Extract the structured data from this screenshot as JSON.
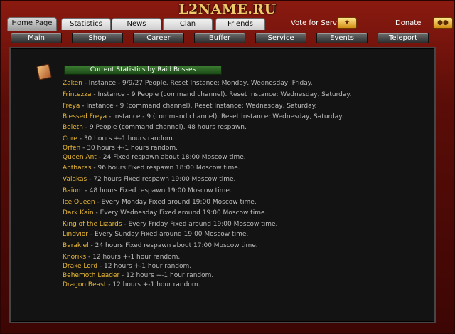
{
  "header": {
    "title": "L2NAME.RU"
  },
  "tabs": [
    {
      "label": "Home Page",
      "active": true
    },
    {
      "label": "Statistics",
      "active": false
    },
    {
      "label": "News",
      "active": false
    },
    {
      "label": "Clan",
      "active": false
    },
    {
      "label": "Friends",
      "active": false
    }
  ],
  "vote": {
    "label": "Vote for Server"
  },
  "donate": {
    "label": "Donate"
  },
  "menu": [
    {
      "label": "Main"
    },
    {
      "label": "Shop"
    },
    {
      "label": "Career"
    },
    {
      "label": "Buffer"
    },
    {
      "label": "Service"
    },
    {
      "label": "Events"
    },
    {
      "label": "Teleport"
    }
  ],
  "content": {
    "heading": "Current Statistics by Raid Bosses",
    "bosses": [
      {
        "name": "Zaken",
        "desc": " - Instance - 9/9/27 People. Reset Instance: Monday, Wednesday, Friday."
      },
      {
        "name": "Frintezza",
        "desc": " - Instance - 9 People  (command channel). Reset Instance: Wednesday, Saturday."
      },
      {
        "name": "Freya",
        "desc": " - Instance - 9  (command channel). Reset Instance: Wednesday, Saturday."
      },
      {
        "name": "Blessed Freya",
        "desc": " - Instance - 9 (command channel). Reset Instance: Wednesday, Saturday."
      },
      {
        "name": "Beleth",
        "desc": " - 9 People (command channel). 48 hours respawn."
      },
      {
        "name": "Core",
        "desc": " - 30 hours +-1 hours random."
      },
      {
        "name": "Orfen",
        "desc": " - 30 hours +-1 hours random."
      },
      {
        "name": "Queen Ant",
        "desc": " - 24 Fixed respawn about 18:00 Moscow time."
      },
      {
        "name": "Antharas",
        "desc": " - 96 hours Fixed respawn 18:00 Moscow time."
      },
      {
        "name": "Valakas",
        "desc": " - 72 hours Fixed respawn 19:00 Moscow time."
      },
      {
        "name": "Baium",
        "desc": " - 48 hours Fixed respawn 19:00 Moscow time."
      },
      {
        "name": "Ice Queen",
        "desc": " - Every Monday Fixed around 19:00 Moscow time."
      },
      {
        "name": "Dark Kain",
        "desc": " - Every Wednesday Fixed around 19:00 Moscow time."
      },
      {
        "name": "King of the Lizards",
        "desc": " - Every Friday Fixed around 19:00 Moscow time."
      },
      {
        "name": "Lindvior",
        "desc": " - Every Sunday Fixed around 19:00 Moscow time."
      },
      {
        "name": "Barakiel",
        "desc": " - 24 hours Fixed respawn about 17:00 Moscow time."
      },
      {
        "name": "Knoriks",
        "desc": " - 12 hours +-1 hour random."
      },
      {
        "name": "Drake Lord",
        "desc": " - 12 hours +-1 hour random."
      },
      {
        "name": "Behemoth Leader",
        "desc": " - 12 hours +-1 hour random."
      },
      {
        "name": "Dragon Beast",
        "desc": " - 12 hours +-1 hour random."
      }
    ]
  }
}
